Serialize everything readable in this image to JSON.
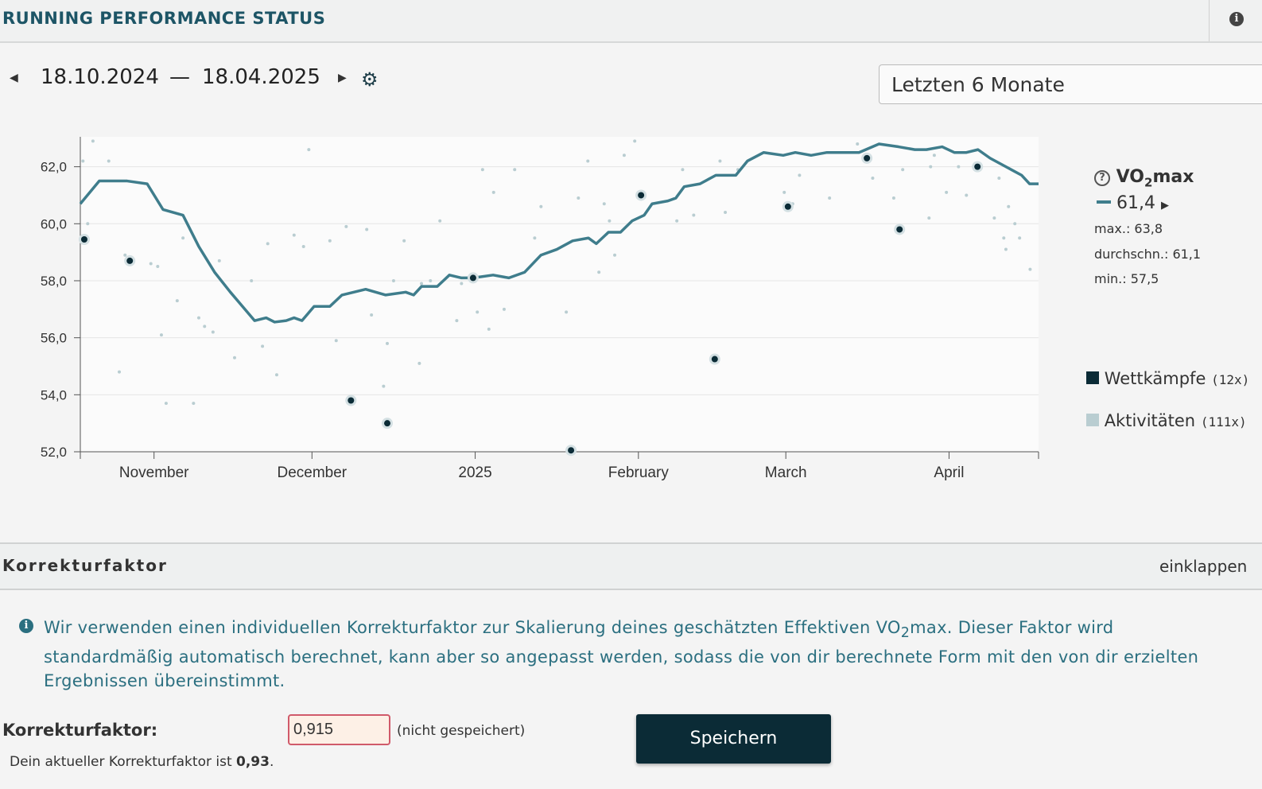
{
  "header": {
    "title": "RUNNING PERFORMANCE STATUS"
  },
  "range": {
    "start": "18.10.2024",
    "dash": "—",
    "end": "18.04.2025",
    "period": "Letzten 6 Monate"
  },
  "legend": {
    "metric_prefix": "VO",
    "metric_sub": "2",
    "metric_suffix": "max",
    "current": "61,4",
    "max": "max.: 63,8",
    "avg": "durchschn.: 61,1",
    "min": "min.: 57,5",
    "competitions": "Wettkämpfe",
    "competitions_count": "(12x)",
    "activities": "Aktivitäten",
    "activities_count": "(111x)"
  },
  "colors": {
    "line": "#3f7d8c",
    "competition": "#0b2b36",
    "activity": "#b9cdd1",
    "accent": "#1d5566"
  },
  "chart_data": {
    "type": "line",
    "x_unit": "days since 18.10.2024",
    "xlim": [
      0,
      182
    ],
    "ylim": [
      52,
      63.05
    ],
    "yticks": [
      52,
      54,
      56,
      58,
      60,
      62
    ],
    "ytick_labels": [
      "52,0",
      "54,0",
      "56,0",
      "58,0",
      "60,0",
      "62,0"
    ],
    "xticks": [
      {
        "day": 14,
        "label": "November"
      },
      {
        "day": 44,
        "label": "December"
      },
      {
        "day": 75,
        "label": "2025"
      },
      {
        "day": 106,
        "label": "February"
      },
      {
        "day": 134,
        "label": "March"
      },
      {
        "day": 165,
        "label": "April"
      }
    ],
    "grid": true,
    "legend_placement": "right",
    "series": [
      {
        "name": "VO2max",
        "type": "line",
        "points": [
          [
            0,
            60.7
          ],
          [
            3.6,
            61.5
          ],
          [
            8.9,
            61.5
          ],
          [
            12.7,
            61.4
          ],
          [
            15.7,
            60.5
          ],
          [
            19.5,
            60.3
          ],
          [
            22.5,
            59.2
          ],
          [
            25.5,
            58.3
          ],
          [
            28.5,
            57.6
          ],
          [
            33.1,
            56.6
          ],
          [
            35.3,
            56.7
          ],
          [
            36.9,
            56.55
          ],
          [
            39.1,
            56.6
          ],
          [
            40.6,
            56.7
          ],
          [
            42.1,
            56.6
          ],
          [
            44.4,
            57.1
          ],
          [
            47.4,
            57.1
          ],
          [
            49.7,
            57.5
          ],
          [
            54.2,
            57.7
          ],
          [
            58,
            57.5
          ],
          [
            61.8,
            57.6
          ],
          [
            63.3,
            57.5
          ],
          [
            64.8,
            57.8
          ],
          [
            67.8,
            57.8
          ],
          [
            70.1,
            58.2
          ],
          [
            72.4,
            58.1
          ],
          [
            74.6,
            58.1
          ],
          [
            78.4,
            58.2
          ],
          [
            81.4,
            58.1
          ],
          [
            84.4,
            58.3
          ],
          [
            87.5,
            58.9
          ],
          [
            90.5,
            59.1
          ],
          [
            93.5,
            59.4
          ],
          [
            96.5,
            59.5
          ],
          [
            98,
            59.3
          ],
          [
            100.3,
            59.7
          ],
          [
            102.6,
            59.7
          ],
          [
            104.8,
            60.1
          ],
          [
            107.1,
            60.3
          ],
          [
            108.6,
            60.7
          ],
          [
            111.6,
            60.8
          ],
          [
            113.1,
            60.9
          ],
          [
            114.7,
            61.3
          ],
          [
            117.7,
            61.4
          ],
          [
            120.7,
            61.7
          ],
          [
            124.5,
            61.7
          ],
          [
            126.7,
            62.2
          ],
          [
            129.8,
            62.5
          ],
          [
            133.5,
            62.4
          ],
          [
            135.8,
            62.5
          ],
          [
            138.8,
            62.4
          ],
          [
            141.8,
            62.5
          ],
          [
            147.9,
            62.5
          ],
          [
            151.7,
            62.8
          ],
          [
            155.4,
            62.7
          ],
          [
            158.5,
            62.6
          ],
          [
            160.7,
            62.6
          ],
          [
            163.7,
            62.7
          ],
          [
            166,
            62.5
          ],
          [
            168.3,
            62.5
          ],
          [
            170.5,
            62.6
          ],
          [
            172.8,
            62.3
          ],
          [
            175.8,
            62
          ],
          [
            178.8,
            61.7
          ],
          [
            180.3,
            61.4
          ],
          [
            182,
            61.4
          ]
        ]
      },
      {
        "name": "Wettkämpfe",
        "type": "scatter",
        "points": [
          [
            0.75,
            59.45
          ],
          [
            9.4,
            58.7
          ],
          [
            51.4,
            53.8
          ],
          [
            58.3,
            53.0
          ],
          [
            74.6,
            58.1
          ],
          [
            93.2,
            52.05
          ],
          [
            106.5,
            61.0
          ],
          [
            120.5,
            55.25
          ],
          [
            134.4,
            60.6
          ],
          [
            149.4,
            62.3
          ],
          [
            155.6,
            59.8
          ],
          [
            170.4,
            62.0
          ]
        ]
      },
      {
        "name": "Aktivitäten",
        "type": "scatter",
        "points": [
          [
            0.5,
            62.2
          ],
          [
            2.4,
            62.9
          ],
          [
            1.4,
            60.0
          ],
          [
            5.4,
            62.2
          ],
          [
            7.4,
            54.8
          ],
          [
            8.5,
            58.9
          ],
          [
            13.4,
            58.6
          ],
          [
            14.7,
            58.5
          ],
          [
            15.4,
            56.1
          ],
          [
            16.3,
            53.7
          ],
          [
            18.4,
            57.3
          ],
          [
            19.5,
            59.5
          ],
          [
            21.5,
            53.7
          ],
          [
            22.5,
            56.7
          ],
          [
            23.6,
            56.4
          ],
          [
            25.2,
            56.2
          ],
          [
            26.4,
            58.7
          ],
          [
            29.3,
            55.3
          ],
          [
            32.5,
            58.0
          ],
          [
            34.6,
            55.7
          ],
          [
            35.6,
            59.3
          ],
          [
            37.3,
            54.7
          ],
          [
            40.6,
            59.6
          ],
          [
            42.4,
            59.2
          ],
          [
            43.4,
            62.6
          ],
          [
            47.4,
            59.4
          ],
          [
            48.6,
            55.9
          ],
          [
            50.5,
            59.9
          ],
          [
            54.4,
            59.8
          ],
          [
            55.3,
            56.8
          ],
          [
            57.6,
            54.3
          ],
          [
            58.3,
            55.8
          ],
          [
            59.5,
            58.0
          ],
          [
            61.5,
            59.4
          ],
          [
            64.4,
            55.1
          ],
          [
            64.8,
            57.9
          ],
          [
            66.5,
            58.0
          ],
          [
            68.3,
            60.1
          ],
          [
            71.5,
            56.6
          ],
          [
            72.4,
            57.9
          ],
          [
            75.4,
            56.9
          ],
          [
            76.4,
            61.9
          ],
          [
            77.6,
            56.3
          ],
          [
            78.5,
            61.1
          ],
          [
            80.5,
            57.0
          ],
          [
            82.5,
            61.9
          ],
          [
            86.3,
            59.5
          ],
          [
            87.5,
            60.6
          ],
          [
            92.3,
            56.9
          ],
          [
            94.6,
            60.9
          ],
          [
            96.4,
            62.2
          ],
          [
            98.5,
            58.3
          ],
          [
            99.5,
            60.7
          ],
          [
            100.5,
            60.1
          ],
          [
            101.5,
            58.9
          ],
          [
            103.3,
            62.4
          ],
          [
            105.3,
            62.9
          ],
          [
            106,
            61.1
          ],
          [
            113.3,
            60.1
          ],
          [
            114.4,
            61.9
          ],
          [
            116.5,
            60.3
          ],
          [
            121.5,
            62.2
          ],
          [
            122.5,
            60.4
          ],
          [
            124.9,
            61.9
          ],
          [
            133.7,
            61.1
          ],
          [
            135.3,
            60.7
          ],
          [
            136.6,
            61.7
          ],
          [
            142.3,
            60.9
          ],
          [
            147.6,
            62.8
          ],
          [
            150.5,
            61.6
          ],
          [
            154.5,
            60.9
          ],
          [
            156.2,
            61.9
          ],
          [
            161.2,
            60.2
          ],
          [
            161.5,
            62.0
          ],
          [
            162.2,
            62.4
          ],
          [
            164.5,
            61.1
          ],
          [
            166.8,
            62.0
          ],
          [
            168.3,
            61.0
          ],
          [
            173.6,
            60.2
          ],
          [
            174.5,
            61.6
          ],
          [
            175.4,
            59.5
          ],
          [
            176.3,
            60.6
          ],
          [
            177.5,
            60.0
          ],
          [
            178.4,
            59.5
          ],
          [
            180.4,
            58.4
          ],
          [
            175.8,
            59.1
          ]
        ]
      }
    ]
  },
  "section": {
    "title": "Korrekturfaktor",
    "collapse": "einklappen"
  },
  "message": {
    "part1": "Wir verwenden einen individuellen Korrekturfaktor zur Skalierung deines geschätzten Effektiven VO",
    "sub": "2",
    "part2": "max. Dieser Faktor wird standardmäßig automatisch berechnet, kann aber so angepasst werden, sodass die von dir berechnete Form mit den von dir erzielten Ergebnissen übereinstimmt."
  },
  "form": {
    "label": "Korrekturfaktor:",
    "value": "0,915",
    "status": "(nicht gespeichert)",
    "save": "Speichern",
    "current_prefix": "Dein aktueller Korrekturfaktor ist ",
    "current_value": "0,93",
    "current_suffix": "."
  }
}
